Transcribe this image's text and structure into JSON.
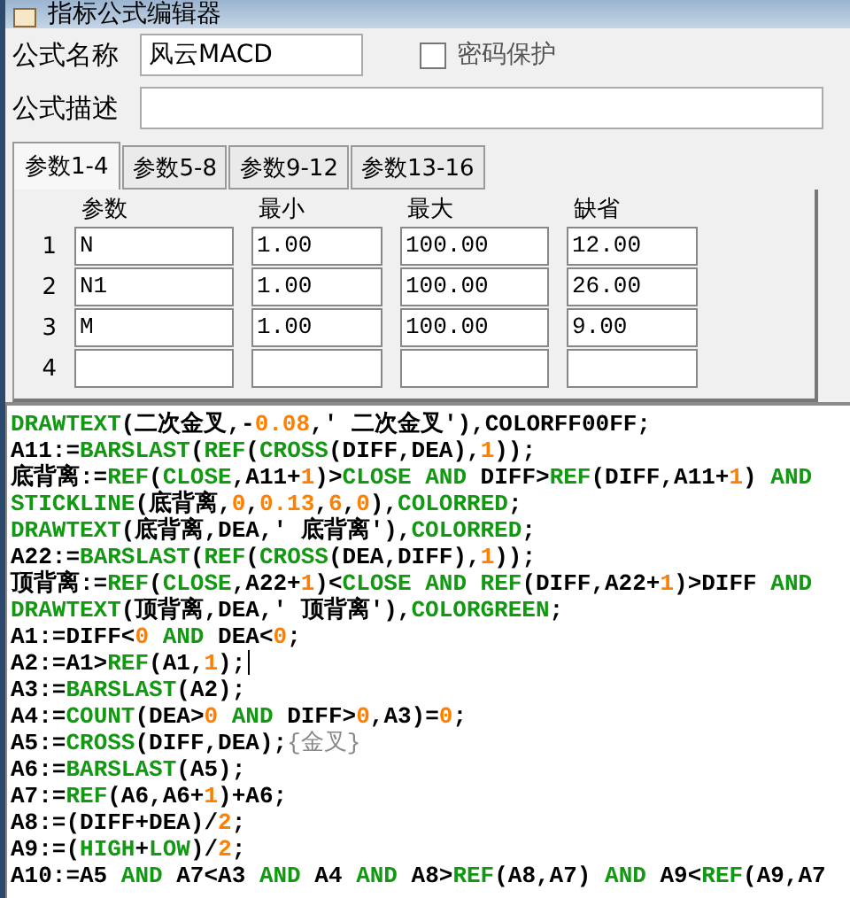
{
  "window": {
    "title": "指标公式编辑器"
  },
  "name_field": {
    "label": "公式名称",
    "value": "风云MACD"
  },
  "password": {
    "label": "密码保护",
    "checked": false
  },
  "description_field": {
    "label": "公式描述"
  },
  "tabs": [
    {
      "label": "参数1-4",
      "selected": true
    },
    {
      "label": "参数5-8",
      "selected": false
    },
    {
      "label": "参数9-12",
      "selected": false
    },
    {
      "label": "参数13-16",
      "selected": false
    }
  ],
  "params": {
    "columns": [
      "参数",
      "最小",
      "最大",
      "缺省"
    ],
    "rows": [
      {
        "index": "1",
        "cells": [
          "N",
          "1.00",
          "100.00",
          "12.00"
        ]
      },
      {
        "index": "2",
        "cells": [
          "N1",
          "1.00",
          "100.00",
          "26.00"
        ]
      },
      {
        "index": "3",
        "cells": [
          "M",
          "1.00",
          "100.00",
          "9.00"
        ]
      },
      {
        "index": "4",
        "cells": [
          "",
          "",
          "",
          ""
        ]
      }
    ]
  },
  "code": {
    "lines": [
      [
        {
          "kind": "keyword",
          "text": "DRAWTEXT"
        },
        {
          "kind": "plain",
          "text": "(二次金叉,-"
        },
        {
          "kind": "number",
          "text": "0.08"
        },
        {
          "kind": "plain",
          "text": ",' 二次金叉'),COLORFF00FF;"
        }
      ],
      [
        {
          "kind": "plain",
          "text": "A11:="
        },
        {
          "kind": "keyword",
          "text": "BARSLAST"
        },
        {
          "kind": "plain",
          "text": "("
        },
        {
          "kind": "keyword",
          "text": "REF"
        },
        {
          "kind": "plain",
          "text": "("
        },
        {
          "kind": "keyword",
          "text": "CROSS"
        },
        {
          "kind": "plain",
          "text": "(DIFF,DEA),"
        },
        {
          "kind": "number",
          "text": "1"
        },
        {
          "kind": "plain",
          "text": "));"
        }
      ],
      [
        {
          "kind": "plain",
          "text": "底背离:="
        },
        {
          "kind": "keyword",
          "text": "REF"
        },
        {
          "kind": "plain",
          "text": "("
        },
        {
          "kind": "keyword",
          "text": "CLOSE"
        },
        {
          "kind": "plain",
          "text": ",A11+"
        },
        {
          "kind": "number",
          "text": "1"
        },
        {
          "kind": "plain",
          "text": ")>"
        },
        {
          "kind": "keyword",
          "text": "CLOSE AND"
        },
        {
          "kind": "plain",
          "text": " DIFF>"
        },
        {
          "kind": "keyword",
          "text": "REF"
        },
        {
          "kind": "plain",
          "text": "(DIFF,A11+"
        },
        {
          "kind": "number",
          "text": "1"
        },
        {
          "kind": "plain",
          "text": ") "
        },
        {
          "kind": "keyword",
          "text": "AND"
        }
      ],
      [
        {
          "kind": "keyword",
          "text": "STICKLINE"
        },
        {
          "kind": "plain",
          "text": "(底背离,"
        },
        {
          "kind": "number",
          "text": "0"
        },
        {
          "kind": "plain",
          "text": ","
        },
        {
          "kind": "number",
          "text": "0.13"
        },
        {
          "kind": "plain",
          "text": ","
        },
        {
          "kind": "number",
          "text": "6"
        },
        {
          "kind": "plain",
          "text": ","
        },
        {
          "kind": "number",
          "text": "0"
        },
        {
          "kind": "plain",
          "text": "),"
        },
        {
          "kind": "keyword",
          "text": "COLORRED"
        },
        {
          "kind": "plain",
          "text": ";"
        }
      ],
      [
        {
          "kind": "keyword",
          "text": "DRAWTEXT"
        },
        {
          "kind": "plain",
          "text": "(底背离,DEA,' 底背离'),"
        },
        {
          "kind": "keyword",
          "text": "COLORRED"
        },
        {
          "kind": "plain",
          "text": ";"
        }
      ],
      [
        {
          "kind": "plain",
          "text": "A22:="
        },
        {
          "kind": "keyword",
          "text": "BARSLAST"
        },
        {
          "kind": "plain",
          "text": "("
        },
        {
          "kind": "keyword",
          "text": "REF"
        },
        {
          "kind": "plain",
          "text": "("
        },
        {
          "kind": "keyword",
          "text": "CROSS"
        },
        {
          "kind": "plain",
          "text": "(DEA,DIFF),"
        },
        {
          "kind": "number",
          "text": "1"
        },
        {
          "kind": "plain",
          "text": "));"
        }
      ],
      [
        {
          "kind": "plain",
          "text": "顶背离:="
        },
        {
          "kind": "keyword",
          "text": "REF"
        },
        {
          "kind": "plain",
          "text": "("
        },
        {
          "kind": "keyword",
          "text": "CLOSE"
        },
        {
          "kind": "plain",
          "text": ",A22+"
        },
        {
          "kind": "number",
          "text": "1"
        },
        {
          "kind": "plain",
          "text": ")<"
        },
        {
          "kind": "keyword",
          "text": "CLOSE AND REF"
        },
        {
          "kind": "plain",
          "text": "(DIFF,A22+"
        },
        {
          "kind": "number",
          "text": "1"
        },
        {
          "kind": "plain",
          "text": ")>DIFF "
        },
        {
          "kind": "keyword",
          "text": "AND"
        }
      ],
      [
        {
          "kind": "keyword",
          "text": "DRAWTEXT"
        },
        {
          "kind": "plain",
          "text": "(顶背离,DEA,' 顶背离'),"
        },
        {
          "kind": "keyword",
          "text": "COLORGREEN"
        },
        {
          "kind": "plain",
          "text": ";"
        }
      ],
      [
        {
          "kind": "plain",
          "text": "A1:=DIFF<"
        },
        {
          "kind": "number",
          "text": "0"
        },
        {
          "kind": "keyword",
          "text": " AND"
        },
        {
          "kind": "plain",
          "text": " DEA<"
        },
        {
          "kind": "number",
          "text": "0"
        },
        {
          "kind": "plain",
          "text": ";"
        }
      ],
      [
        {
          "kind": "plain",
          "text": "A2:=A1>"
        },
        {
          "kind": "keyword",
          "text": "REF"
        },
        {
          "kind": "plain",
          "text": "(A1,"
        },
        {
          "kind": "number",
          "text": "1"
        },
        {
          "kind": "plain",
          "text": ");"
        },
        {
          "kind": "cursor"
        }
      ],
      [
        {
          "kind": "plain",
          "text": "A3:="
        },
        {
          "kind": "keyword",
          "text": "BARSLAST"
        },
        {
          "kind": "plain",
          "text": "(A2);"
        }
      ],
      [
        {
          "kind": "plain",
          "text": "A4:="
        },
        {
          "kind": "keyword",
          "text": "COUNT"
        },
        {
          "kind": "plain",
          "text": "(DEA>"
        },
        {
          "kind": "number",
          "text": "0"
        },
        {
          "kind": "keyword",
          "text": " AND"
        },
        {
          "kind": "plain",
          "text": " DIFF>"
        },
        {
          "kind": "number",
          "text": "0"
        },
        {
          "kind": "plain",
          "text": ",A3)="
        },
        {
          "kind": "number",
          "text": "0"
        },
        {
          "kind": "plain",
          "text": ";"
        }
      ],
      [
        {
          "kind": "plain",
          "text": "A5:="
        },
        {
          "kind": "keyword",
          "text": "CROSS"
        },
        {
          "kind": "plain",
          "text": "(DIFF,DEA);"
        },
        {
          "kind": "comment",
          "text": "{金叉}"
        }
      ],
      [
        {
          "kind": "plain",
          "text": "A6:="
        },
        {
          "kind": "keyword",
          "text": "BARSLAST"
        },
        {
          "kind": "plain",
          "text": "(A5);"
        }
      ],
      [
        {
          "kind": "plain",
          "text": "A7:="
        },
        {
          "kind": "keyword",
          "text": "REF"
        },
        {
          "kind": "plain",
          "text": "(A6,A6+"
        },
        {
          "kind": "number",
          "text": "1"
        },
        {
          "kind": "plain",
          "text": ")+A6;"
        }
      ],
      [
        {
          "kind": "plain",
          "text": "A8:=(DIFF+DEA)/"
        },
        {
          "kind": "number",
          "text": "2"
        },
        {
          "kind": "plain",
          "text": ";"
        }
      ],
      [
        {
          "kind": "plain",
          "text": "A9:=("
        },
        {
          "kind": "keyword",
          "text": "HIGH"
        },
        {
          "kind": "plain",
          "text": "+"
        },
        {
          "kind": "keyword",
          "text": "LOW"
        },
        {
          "kind": "plain",
          "text": ")/"
        },
        {
          "kind": "number",
          "text": "2"
        },
        {
          "kind": "plain",
          "text": ";"
        }
      ],
      [
        {
          "kind": "plain",
          "text": "A10:=A5 "
        },
        {
          "kind": "keyword",
          "text": "AND"
        },
        {
          "kind": "plain",
          "text": " A7<A3 "
        },
        {
          "kind": "keyword",
          "text": "AND"
        },
        {
          "kind": "plain",
          "text": " A4 "
        },
        {
          "kind": "keyword",
          "text": "AND"
        },
        {
          "kind": "plain",
          "text": " A8>"
        },
        {
          "kind": "keyword",
          "text": "REF"
        },
        {
          "kind": "plain",
          "text": "(A8,A7) "
        },
        {
          "kind": "keyword",
          "text": "AND"
        },
        {
          "kind": "plain",
          "text": " A9<"
        },
        {
          "kind": "keyword",
          "text": "REF"
        },
        {
          "kind": "plain",
          "text": "(A9,A7"
        }
      ]
    ]
  }
}
